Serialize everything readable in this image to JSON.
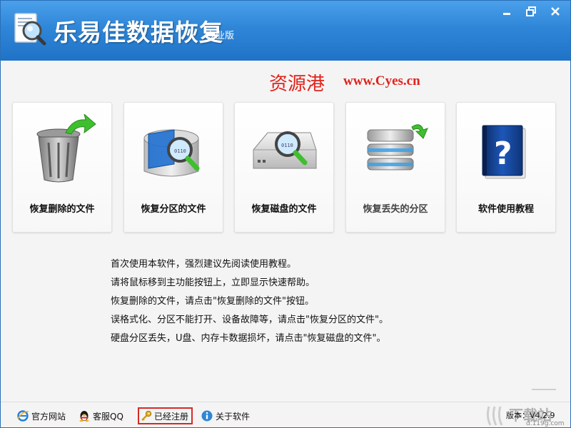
{
  "titlebar": {
    "title": "乐易佳数据恢复",
    "edition": "专业版"
  },
  "watermark": {
    "chinese": "资源港",
    "url": "www.Cyes.cn"
  },
  "features": [
    {
      "label": "恢复删除的文件",
      "icon": "recycle-bin-icon"
    },
    {
      "label": "恢复分区的文件",
      "icon": "partition-magnifier-icon"
    },
    {
      "label": "恢复磁盘的文件",
      "icon": "disk-magnifier-icon"
    },
    {
      "label": "恢复丢失的分区",
      "icon": "server-stack-icon"
    },
    {
      "label": "软件使用教程",
      "icon": "help-book-icon"
    }
  ],
  "help_lines": [
    "首次使用本软件，强烈建议先阅读使用教程。",
    "请将鼠标移到主功能按钮上，立即显示快速帮助。",
    "恢复删除的文件，请点击\"恢复删除的文件\"按钮。",
    "误格式化、分区不能打开、设备故障等，请点击\"恢复分区的文件\"。",
    "硬盘分区丢失，U盘、内存卡数据损坏，请点击\"恢复磁盘的文件\"。"
  ],
  "bottombar": {
    "website": "官方网站",
    "support": "客服QQ",
    "registered": "已经注册",
    "about": "关于软件",
    "version": "版本：V4.2.9",
    "site_mark_big": "下载站",
    "site_mark_small": "d.119g.com"
  },
  "colors": {
    "titlebar": "#2f86d8",
    "watermark_red": "#e0231c",
    "registered_border": "#d42a2a"
  }
}
